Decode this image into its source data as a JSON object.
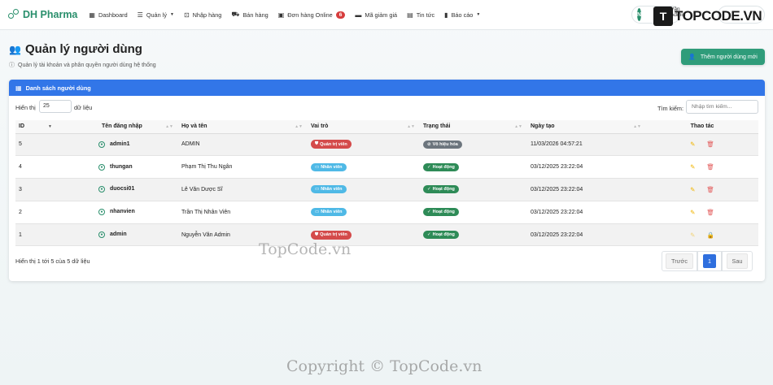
{
  "nav": {
    "brand": "DH Pharma",
    "items": [
      {
        "label": "Dashboard",
        "icon": "dashboard-icon"
      },
      {
        "label": "Quản lý",
        "icon": "database-icon",
        "dropdown": true
      },
      {
        "label": "Nhập hàng",
        "icon": "import-icon"
      },
      {
        "label": "Bán hàng",
        "icon": "cart-icon"
      },
      {
        "label": "Đơn hàng Online",
        "icon": "box-icon",
        "badge": "6"
      },
      {
        "label": "Mã giảm giá",
        "icon": "ticket-icon"
      },
      {
        "label": "Tin tức",
        "icon": "news-icon"
      },
      {
        "label": "Báo cáo",
        "icon": "chart-icon",
        "dropdown": true
      }
    ],
    "user": {
      "initial": "N",
      "name": "Văn Admin"
    },
    "watermark_logo": "TOPCODE.VN"
  },
  "page": {
    "title": "Quản lý người dùng",
    "subtitle": "Quản lý tài khoản và phân quyền người dùng hệ thống",
    "add_button": "Thêm người dùng mới"
  },
  "card": {
    "title": "Danh sách người dùng",
    "show_label": "Hiển thị",
    "show_value": "25",
    "show_after": "dữ liệu",
    "search_label": "Tìm kiếm:",
    "search_placeholder": "Nhập tìm kiếm...",
    "columns": [
      "ID",
      "Tên đăng nhập",
      "Họ và tên",
      "Vai trò",
      "Trạng thái",
      "Ngày tạo",
      "Thao tác"
    ],
    "rows": [
      {
        "id": "5",
        "username": "admin1",
        "fullname": "ADMIN",
        "role": "Quản trị viên",
        "status": "Vô hiệu hóa",
        "created": "11/03/2026 04:57:21"
      },
      {
        "id": "4",
        "username": "thungan",
        "fullname": "Phạm Thị Thu Ngân",
        "role": "Nhân viên",
        "status": "Hoạt động",
        "created": "03/12/2025 23:22:04"
      },
      {
        "id": "3",
        "username": "duocsi01",
        "fullname": "Lê Văn Dược Sĩ",
        "role": "Nhân viên",
        "status": "Hoạt động",
        "created": "03/12/2025 23:22:04"
      },
      {
        "id": "2",
        "username": "nhanvien",
        "fullname": "Trần Thị Nhân Viên",
        "role": "Nhân viên",
        "status": "Hoạt động",
        "created": "03/12/2025 23:22:04"
      },
      {
        "id": "1",
        "username": "admin",
        "fullname": "Nguyễn Văn Admin",
        "role": "Quản trị viên",
        "status": "Hoạt động",
        "created": "03/12/2025 23:22:04"
      }
    ],
    "info": "Hiển thị 1 tới 5 của 5 dữ liệu",
    "pager": {
      "prev": "Trước",
      "current": "1",
      "next": "Sau"
    }
  },
  "watermarks": {
    "center": "TopCode.vn",
    "bottom": "Copyright © TopCode.vn"
  },
  "colors": {
    "brand": "#2a8f6c",
    "header": "#3276e8",
    "admin": "#d44b4b",
    "staff": "#4fb9e6",
    "active": "#2e8b57",
    "inactive": "#6c757d"
  }
}
